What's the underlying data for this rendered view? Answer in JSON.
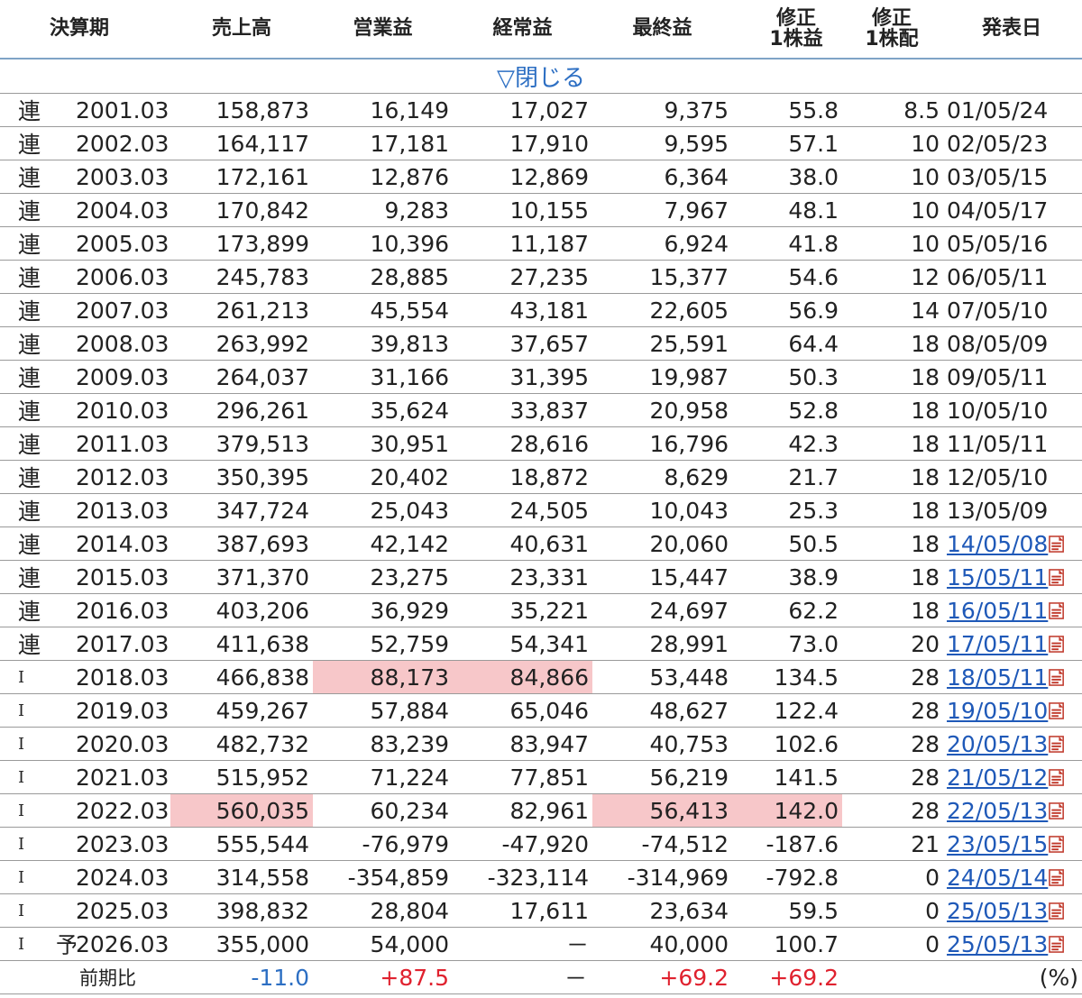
{
  "headers": {
    "period": "決算期",
    "revenue": "売上高",
    "operating": "営業益",
    "ordinary": "経常益",
    "net": "最終益",
    "eps_line1": "修正",
    "eps_line2": "1株益",
    "dps_line1": "修正",
    "dps_line2": "1株配",
    "date": "発表日"
  },
  "toggle": {
    "label": "▽閉じる"
  },
  "rows": [
    {
      "type": "連",
      "forecast": "",
      "period": "2001.03",
      "revenue": "158,873",
      "operating": "16,149",
      "ordinary": "17,027",
      "net": "9,375",
      "eps": "55.8",
      "dps": "8.5",
      "date": "01/05/24",
      "link": false,
      "hl": []
    },
    {
      "type": "連",
      "forecast": "",
      "period": "2002.03",
      "revenue": "164,117",
      "operating": "17,181",
      "ordinary": "17,910",
      "net": "9,595",
      "eps": "57.1",
      "dps": "10",
      "date": "02/05/23",
      "link": false,
      "hl": []
    },
    {
      "type": "連",
      "forecast": "",
      "period": "2003.03",
      "revenue": "172,161",
      "operating": "12,876",
      "ordinary": "12,869",
      "net": "6,364",
      "eps": "38.0",
      "dps": "10",
      "date": "03/05/15",
      "link": false,
      "hl": []
    },
    {
      "type": "連",
      "forecast": "",
      "period": "2004.03",
      "revenue": "170,842",
      "operating": "9,283",
      "ordinary": "10,155",
      "net": "7,967",
      "eps": "48.1",
      "dps": "10",
      "date": "04/05/17",
      "link": false,
      "hl": []
    },
    {
      "type": "連",
      "forecast": "",
      "period": "2005.03",
      "revenue": "173,899",
      "operating": "10,396",
      "ordinary": "11,187",
      "net": "6,924",
      "eps": "41.8",
      "dps": "10",
      "date": "05/05/16",
      "link": false,
      "hl": []
    },
    {
      "type": "連",
      "forecast": "",
      "period": "2006.03",
      "revenue": "245,783",
      "operating": "28,885",
      "ordinary": "27,235",
      "net": "15,377",
      "eps": "54.6",
      "dps": "12",
      "date": "06/05/11",
      "link": false,
      "hl": []
    },
    {
      "type": "連",
      "forecast": "",
      "period": "2007.03",
      "revenue": "261,213",
      "operating": "45,554",
      "ordinary": "43,181",
      "net": "22,605",
      "eps": "56.9",
      "dps": "14",
      "date": "07/05/10",
      "link": false,
      "hl": []
    },
    {
      "type": "連",
      "forecast": "",
      "period": "2008.03",
      "revenue": "263,992",
      "operating": "39,813",
      "ordinary": "37,657",
      "net": "25,591",
      "eps": "64.4",
      "dps": "18",
      "date": "08/05/09",
      "link": false,
      "hl": []
    },
    {
      "type": "連",
      "forecast": "",
      "period": "2009.03",
      "revenue": "264,037",
      "operating": "31,166",
      "ordinary": "31,395",
      "net": "19,987",
      "eps": "50.3",
      "dps": "18",
      "date": "09/05/11",
      "link": false,
      "hl": []
    },
    {
      "type": "連",
      "forecast": "",
      "period": "2010.03",
      "revenue": "296,261",
      "operating": "35,624",
      "ordinary": "33,837",
      "net": "20,958",
      "eps": "52.8",
      "dps": "18",
      "date": "10/05/10",
      "link": false,
      "hl": []
    },
    {
      "type": "連",
      "forecast": "",
      "period": "2011.03",
      "revenue": "379,513",
      "operating": "30,951",
      "ordinary": "28,616",
      "net": "16,796",
      "eps": "42.3",
      "dps": "18",
      "date": "11/05/11",
      "link": false,
      "hl": []
    },
    {
      "type": "連",
      "forecast": "",
      "period": "2012.03",
      "revenue": "350,395",
      "operating": "20,402",
      "ordinary": "18,872",
      "net": "8,629",
      "eps": "21.7",
      "dps": "18",
      "date": "12/05/10",
      "link": false,
      "hl": []
    },
    {
      "type": "連",
      "forecast": "",
      "period": "2013.03",
      "revenue": "347,724",
      "operating": "25,043",
      "ordinary": "24,505",
      "net": "10,043",
      "eps": "25.3",
      "dps": "18",
      "date": "13/05/09",
      "link": false,
      "hl": []
    },
    {
      "type": "連",
      "forecast": "",
      "period": "2014.03",
      "revenue": "387,693",
      "operating": "42,142",
      "ordinary": "40,631",
      "net": "20,060",
      "eps": "50.5",
      "dps": "18",
      "date": "14/05/08",
      "link": true,
      "hl": []
    },
    {
      "type": "連",
      "forecast": "",
      "period": "2015.03",
      "revenue": "371,370",
      "operating": "23,275",
      "ordinary": "23,331",
      "net": "15,447",
      "eps": "38.9",
      "dps": "18",
      "date": "15/05/11",
      "link": true,
      "hl": []
    },
    {
      "type": "連",
      "forecast": "",
      "period": "2016.03",
      "revenue": "403,206",
      "operating": "36,929",
      "ordinary": "35,221",
      "net": "24,697",
      "eps": "62.2",
      "dps": "18",
      "date": "16/05/11",
      "link": true,
      "hl": []
    },
    {
      "type": "連",
      "forecast": "",
      "period": "2017.03",
      "revenue": "411,638",
      "operating": "52,759",
      "ordinary": "54,341",
      "net": "28,991",
      "eps": "73.0",
      "dps": "20",
      "date": "17/05/11",
      "link": true,
      "hl": []
    },
    {
      "type": "I",
      "forecast": "",
      "period": "2018.03",
      "revenue": "466,838",
      "operating": "88,173",
      "ordinary": "84,866",
      "net": "53,448",
      "eps": "134.5",
      "dps": "28",
      "date": "18/05/11",
      "link": true,
      "hl": [
        "operating",
        "ordinary"
      ]
    },
    {
      "type": "I",
      "forecast": "",
      "period": "2019.03",
      "revenue": "459,267",
      "operating": "57,884",
      "ordinary": "65,046",
      "net": "48,627",
      "eps": "122.4",
      "dps": "28",
      "date": "19/05/10",
      "link": true,
      "hl": []
    },
    {
      "type": "I",
      "forecast": "",
      "period": "2020.03",
      "revenue": "482,732",
      "operating": "83,239",
      "ordinary": "83,947",
      "net": "40,753",
      "eps": "102.6",
      "dps": "28",
      "date": "20/05/13",
      "link": true,
      "hl": []
    },
    {
      "type": "I",
      "forecast": "",
      "period": "2021.03",
      "revenue": "515,952",
      "operating": "71,224",
      "ordinary": "77,851",
      "net": "56,219",
      "eps": "141.5",
      "dps": "28",
      "date": "21/05/12",
      "link": true,
      "hl": []
    },
    {
      "type": "I",
      "forecast": "",
      "period": "2022.03",
      "revenue": "560,035",
      "operating": "60,234",
      "ordinary": "82,961",
      "net": "56,413",
      "eps": "142.0",
      "dps": "28",
      "date": "22/05/13",
      "link": true,
      "hl": [
        "revenue",
        "net",
        "eps"
      ]
    },
    {
      "type": "I",
      "forecast": "",
      "period": "2023.03",
      "revenue": "555,544",
      "operating": "-76,979",
      "ordinary": "-47,920",
      "net": "-74,512",
      "eps": "-187.6",
      "dps": "21",
      "date": "23/05/15",
      "link": true,
      "hl": []
    },
    {
      "type": "I",
      "forecast": "",
      "period": "2024.03",
      "revenue": "314,558",
      "operating": "-354,859",
      "ordinary": "-323,114",
      "net": "-314,969",
      "eps": "-792.8",
      "dps": "0",
      "date": "24/05/14",
      "link": true,
      "hl": []
    },
    {
      "type": "I",
      "forecast": "",
      "period": "2025.03",
      "revenue": "398,832",
      "operating": "28,804",
      "ordinary": "17,611",
      "net": "23,634",
      "eps": "59.5",
      "dps": "0",
      "date": "25/05/13",
      "link": true,
      "hl": []
    },
    {
      "type": "I",
      "forecast": "予",
      "period": "2026.03",
      "revenue": "355,000",
      "operating": "54,000",
      "ordinary": "－",
      "net": "40,000",
      "eps": "100.7",
      "dps": "0",
      "date": "25/05/13",
      "link": true,
      "hl": []
    }
  ],
  "ratio": {
    "label": "前期比",
    "revenue": "-11.0",
    "operating": "+87.5",
    "ordinary": "－",
    "net": "+69.2",
    "eps": "+69.2",
    "unit": "(%)"
  },
  "icons": {
    "pdf": "pdf-icon"
  },
  "colors": {
    "highlight": "#f7c7c9",
    "link": "#1f59b8",
    "negative": "#2d6fc3",
    "positive": "#e0222f",
    "header_rule": "#7fa3c6"
  }
}
